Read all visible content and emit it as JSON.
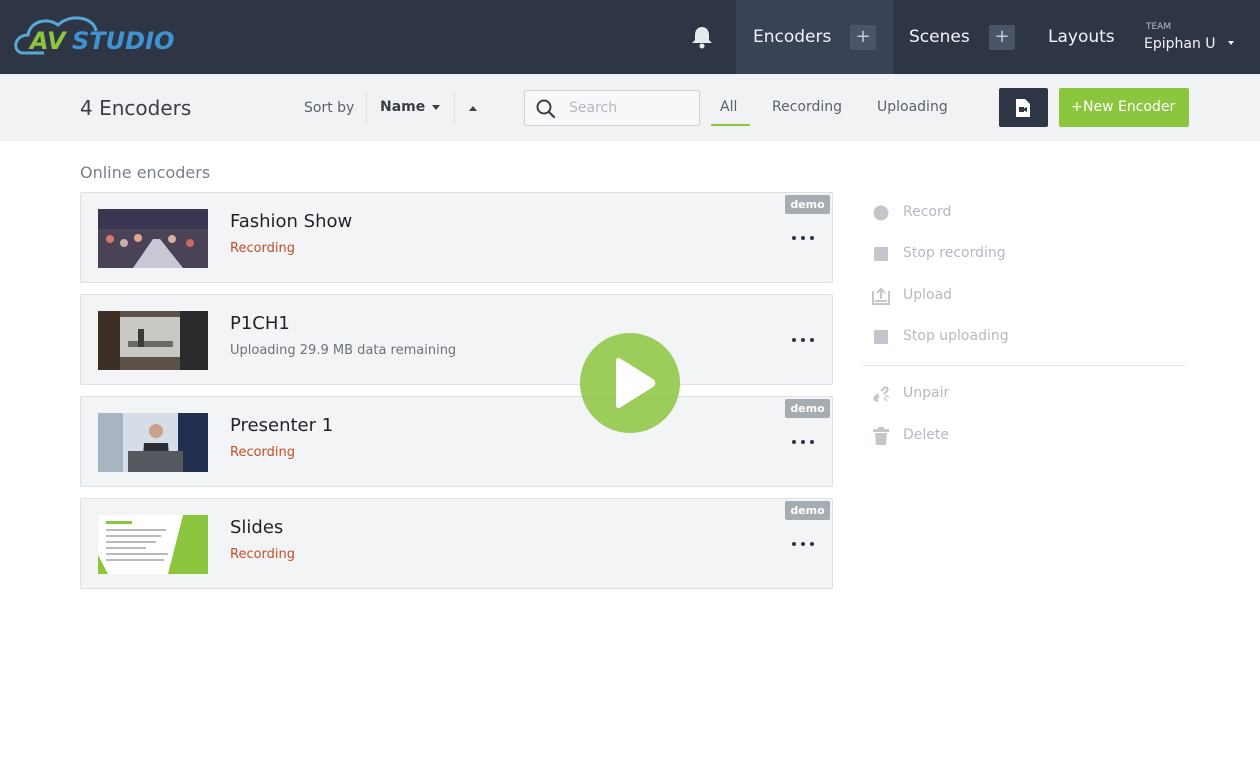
{
  "app": {
    "logo_text": "AVSTUDIO"
  },
  "nav": {
    "encoders_label": "Encoders",
    "scenes_label": "Scenes",
    "layouts_label": "Layouts",
    "plus_label": "+",
    "team_label": "TEAM",
    "team_name": "Epiphan U"
  },
  "toolbar": {
    "count_title": "4 Encoders",
    "sort_by_label": "Sort by",
    "sort_field": "Name",
    "search_placeholder": "Search",
    "filters": {
      "all": "All",
      "recording": "Recording",
      "uploading": "Uploading"
    },
    "new_encoder_plus": "+",
    "new_encoder_label": "New Encoder"
  },
  "main": {
    "section_title": "Online encoders",
    "encoders": [
      {
        "name": "Fashion Show",
        "status": "Recording",
        "badge": "demo"
      },
      {
        "name": "P1CH1",
        "status": "Uploading 29.9 MB data remaining",
        "badge": ""
      },
      {
        "name": "Presenter 1",
        "status": "Recording",
        "badge": "demo"
      },
      {
        "name": "Slides",
        "status": "Recording",
        "badge": "demo"
      }
    ]
  },
  "actions": {
    "record": "Record",
    "stop_recording": "Stop recording",
    "upload": "Upload",
    "stop_uploading": "Stop uploading",
    "unpair": "Unpair",
    "delete": "Delete"
  },
  "colors": {
    "nav_bg": "#2e3646",
    "accent": "#8cc63f",
    "recording": "#c44d2a"
  }
}
